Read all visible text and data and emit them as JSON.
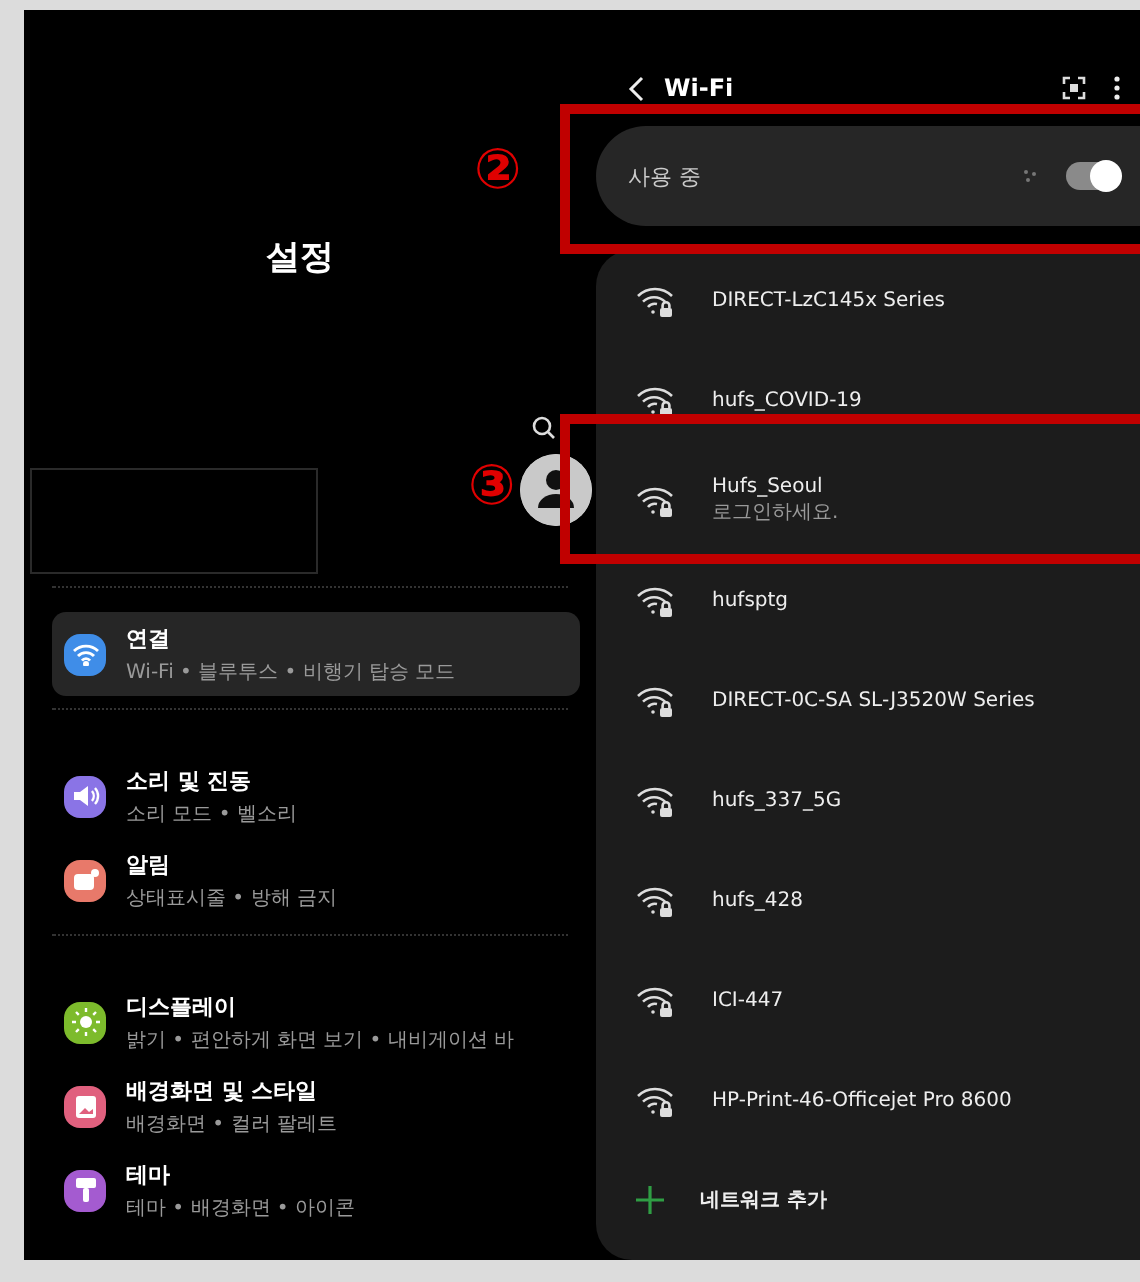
{
  "settings": {
    "title": "설정",
    "groups": [
      {
        "items": [
          {
            "kind": "wifi",
            "title": "연결",
            "subtitle": "Wi-Fi • 블루투스 • 비행기 탑승 모드",
            "color": "#3f8de8",
            "selected": true
          }
        ]
      },
      {
        "items": [
          {
            "kind": "sound",
            "title": "소리 및 진동",
            "subtitle": "소리 모드 • 벨소리",
            "color": "#8a74e6",
            "selected": false
          },
          {
            "kind": "notification",
            "title": "알림",
            "subtitle": "상태표시줄 • 방해 금지",
            "color": "#e8796a",
            "selected": false
          }
        ]
      },
      {
        "items": [
          {
            "kind": "display",
            "title": "디스플레이",
            "subtitle": "밝기 • 편안하게 화면 보기 • 내비게이션 바",
            "color": "#7dbb2c",
            "selected": false
          },
          {
            "kind": "wallpaper",
            "title": "배경화면 및 스타일",
            "subtitle": "배경화면 • 컬러 팔레트",
            "color": "#e0607e",
            "selected": false
          },
          {
            "kind": "theme",
            "title": "테마",
            "subtitle": "테마 • 배경화면 • 아이콘",
            "color": "#a45bd0",
            "selected": false
          }
        ]
      }
    ]
  },
  "wifi": {
    "title": "Wi-Fi",
    "status_label": "사용 중",
    "on": true,
    "networks": [
      {
        "name": "DIRECT-LzC145x Series"
      },
      {
        "name": "hufs_COVID-19"
      },
      {
        "name": "Hufs_Seoul",
        "status": "로그인하세요."
      },
      {
        "name": "hufsptg"
      },
      {
        "name": "DIRECT-0C-SA SL-J3520W Series"
      },
      {
        "name": "hufs_337_5G"
      },
      {
        "name": "hufs_428"
      },
      {
        "name": "ICI-447"
      },
      {
        "name": "HP-Print-46-Officejet Pro 8600"
      }
    ],
    "add_network": "네트워크 추가"
  },
  "annotations": [
    {
      "label": "②"
    },
    {
      "label": "③"
    }
  ]
}
